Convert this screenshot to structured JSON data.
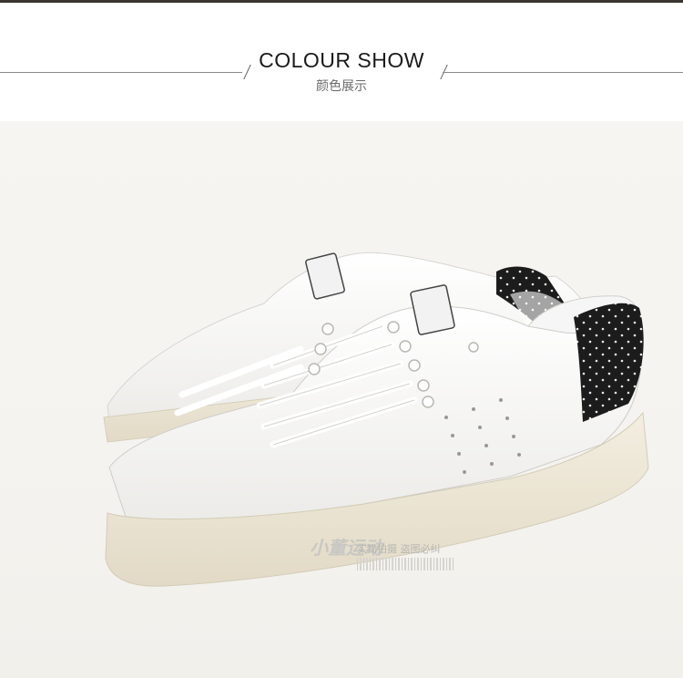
{
  "header": {
    "title": "COLOUR SHOW",
    "subtitle": "颜色展示"
  },
  "photo": {
    "subject": "white-leather-sneakers-black-polka-dot-heel",
    "watermark": {
      "logo_text": "小董运动",
      "caption": "实物拍摄 盗图必纠"
    }
  },
  "colors": {
    "top_rule": "#3a3530",
    "background": "#f5f3ef",
    "shoe_upper": "#fdfdfd",
    "sole": "#ede7d6",
    "heel_tab": "#1e1e1e"
  }
}
